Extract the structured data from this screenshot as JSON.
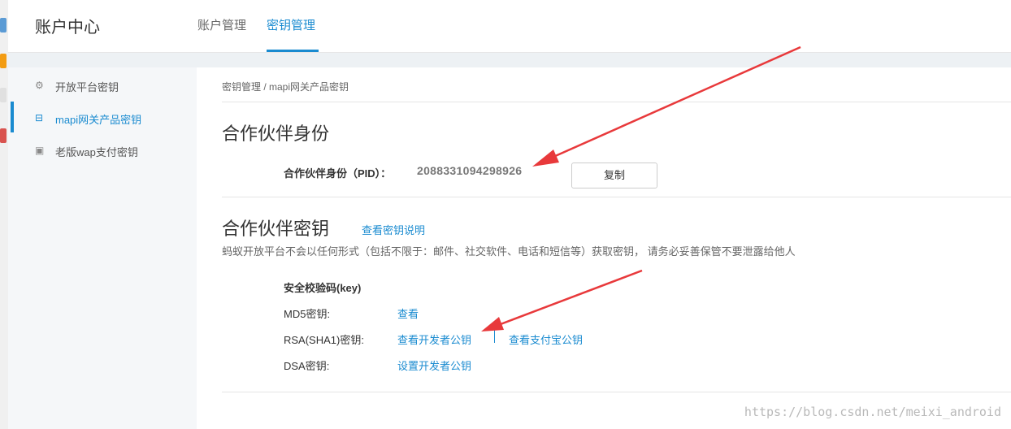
{
  "header": {
    "brand": "账户中心",
    "tabs": [
      {
        "label": "账户管理",
        "active": false
      },
      {
        "label": "密钥管理",
        "active": true
      }
    ]
  },
  "sidebar": {
    "items": [
      {
        "label": "开放平台密钥",
        "icon": "gear-icon",
        "active": false
      },
      {
        "label": "mapi网关产品密钥",
        "icon": "gateway-icon",
        "active": true
      },
      {
        "label": "老版wap支付密钥",
        "icon": "wallet-icon",
        "active": false
      }
    ]
  },
  "breadcrumb": "密钥管理 / mapi网关产品密钥",
  "partner_id": {
    "title": "合作伙伴身份",
    "label": "合作伙伴身份（PID）：",
    "value": "2088331094298926",
    "copy_label": "复制"
  },
  "partner_key": {
    "title": "合作伙伴密钥",
    "help_link": "查看密钥说明",
    "description": "蚂蚁开放平台不会以任何形式（包括不限于：邮件、社交软件、电话和短信等）获取密钥，  请务必妥善保管不要泄露给他人",
    "section_title": "安全校验码(key)",
    "rows": [
      {
        "label": "MD5密钥:",
        "links": [
          "查看"
        ]
      },
      {
        "label": "RSA(SHA1)密钥:",
        "links": [
          "查看开发者公钥",
          "查看支付宝公钥"
        ]
      },
      {
        "label": "DSA密钥:",
        "links": [
          "设置开发者公钥"
        ]
      }
    ]
  },
  "watermark": "https://blog.csdn.net/meixi_android",
  "colors": {
    "accent": "#1a8bd0",
    "arrow": "#e8393b",
    "sidebar_bg": "#f5f7f9"
  }
}
